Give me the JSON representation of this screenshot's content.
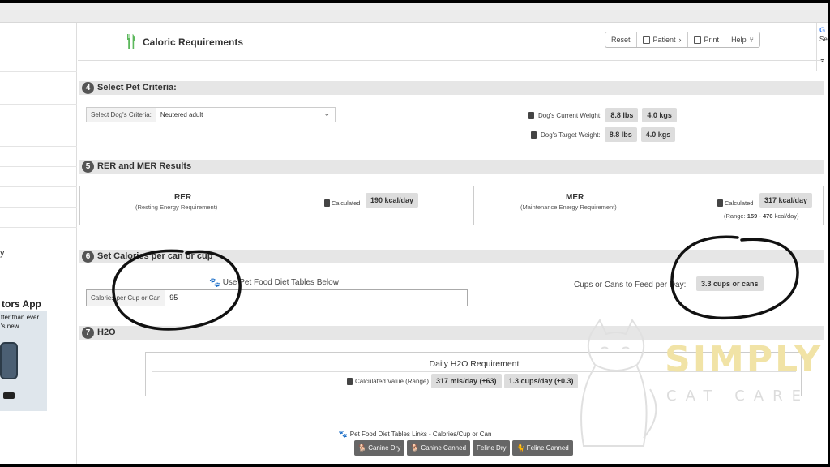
{
  "header": {
    "title": "Caloric Requirements",
    "toolbar": {
      "reset": "Reset",
      "patient": "Patient",
      "print": "Print",
      "help": "Help"
    }
  },
  "right_edge": {
    "g": "G",
    "s": "Se"
  },
  "sidebar": {
    "fragment_y": "y",
    "ad_title": "tors App",
    "ad_line1": "tter than ever.",
    "ad_line2": "'s new."
  },
  "sections": {
    "s4": {
      "num": "4",
      "title": "Select Pet Criteria:"
    },
    "s5": {
      "num": "5",
      "title": "RER and MER Results"
    },
    "s6": {
      "num": "6",
      "title": "Set Calories per can or cup"
    },
    "s7": {
      "num": "7",
      "title": "H2O"
    }
  },
  "criteria": {
    "label": "Select Dog's Criteria:",
    "value": "Neutered adult",
    "current_weight_label": "Dog's Current Weight:",
    "current_lbs": "8.8 lbs",
    "current_kgs": "4.0 kgs",
    "target_weight_label": "Dog's Target Weight:",
    "target_lbs": "8.8 lbs",
    "target_kgs": "4.0 kgs"
  },
  "rer": {
    "title": "RER",
    "subtitle": "(Resting Energy Requirement)",
    "calc_label": "Calculated",
    "value": "190 kcal/day"
  },
  "mer": {
    "title": "MER",
    "subtitle": "(Maintenance Energy Requirement)",
    "calc_label": "Calculated",
    "value": "317 kcal/day",
    "range_prefix": "(Range: ",
    "range_low": "159",
    "range_sep": " - ",
    "range_high": "476",
    "range_suffix": " kcal/day)"
  },
  "calories": {
    "use_tables": "Use Pet Food Diet Tables Below",
    "input_label": "Calories per Cup or Can",
    "input_value": "95",
    "cups_label": "Cups or Cans to Feed per Day:",
    "cups_value": "3.3 cups or cans"
  },
  "h2o": {
    "title": "Daily H2O Requirement",
    "calc_label": "Calculated Value (Range)",
    "mls": "317 mls/day (±63)",
    "cups": "1.3 cups/day (±0.3)"
  },
  "links": {
    "title": "Pet Food Diet Tables Links - Calories/Cup or Can",
    "canine_dry": "Canine Dry",
    "canine_canned": "Canine Canned",
    "feline_dry": "Feline Dry",
    "feline_canned": "Feline Canned"
  },
  "watermark": {
    "line1": "SIMPLY",
    "line2": "CAT CARE"
  },
  "colors": {
    "section_bar": "#e6e6e6",
    "value_box": "#dddddd",
    "link_button": "#666666",
    "brand_gold": "#f1e3a6"
  }
}
